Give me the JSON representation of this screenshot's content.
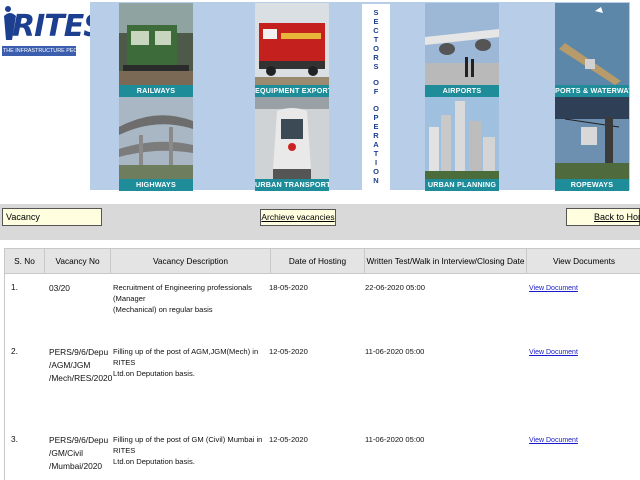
{
  "header": {
    "logo_text": "RITES",
    "logo_tagline": "THE INFRASTRUCTURE PEOPLE",
    "sectors_vertical_words": [
      "SECTORS",
      "OF",
      "OPERATION"
    ],
    "tiles": [
      {
        "label": "RAILWAYS"
      },
      {
        "label": "EQUIPMENT EXPORT"
      },
      {
        "label": "AIRPORTS"
      },
      {
        "label": "PORTS & WATERWAYS"
      },
      {
        "label": "HIGHWAYS"
      },
      {
        "label": "URBAN TRANSPORT"
      },
      {
        "label": "URBAN PLANNING"
      },
      {
        "label": "ROPEWAYS"
      }
    ]
  },
  "toolbar": {
    "vacancy_label": "Vacancy",
    "archive_label": "Archieve vacancies",
    "home_label": "Back to Home"
  },
  "table": {
    "columns": [
      "S. No",
      "Vacancy No",
      "Vacancy Description",
      "Date of Hosting",
      "Written Test/Walk in Interview/Closing Date",
      "View Documents"
    ],
    "rows": [
      {
        "sno": "1.",
        "vacancy_no": [
          "03/20"
        ],
        "description": [
          "Recruitment of Engineering professionals (Manager",
          "(Mechanical) on regular basis"
        ],
        "date_hosting": "18-05-2020",
        "closing_date": "22-06-2020 05:00",
        "doc_link": "View Document"
      },
      {
        "sno": "2.",
        "vacancy_no": [
          "PERS/9/6/Depu",
          "/AGM/JGM",
          "/Mech/RES/2020"
        ],
        "description": [
          "Filling up of the post of AGM,JGM(Mech) in RITES",
          "Ltd.on Deputation basis."
        ],
        "date_hosting": "12-05-2020",
        "closing_date": "11-06-2020 05:00",
        "doc_link": "View Document"
      },
      {
        "sno": "3.",
        "vacancy_no": [
          "PERS/9/6/Depu",
          "/GM/Civil",
          "/Mumbai/2020"
        ],
        "description": [
          "Filling up of the post of GM (Civil) Mumbai in RITES",
          "Ltd.on Deputation basis."
        ],
        "date_hosting": "12-05-2020",
        "closing_date": "11-06-2020 05:00",
        "doc_link": "View Document"
      }
    ]
  },
  "colors": {
    "caption_teal": "#1f8c99",
    "sector_bg": "#b8cde8",
    "brand_blue": "#1d3f8f",
    "button_fill": "#ffffe0",
    "header_grey": "#e4e4e4",
    "link_blue": "#1a1acc"
  }
}
